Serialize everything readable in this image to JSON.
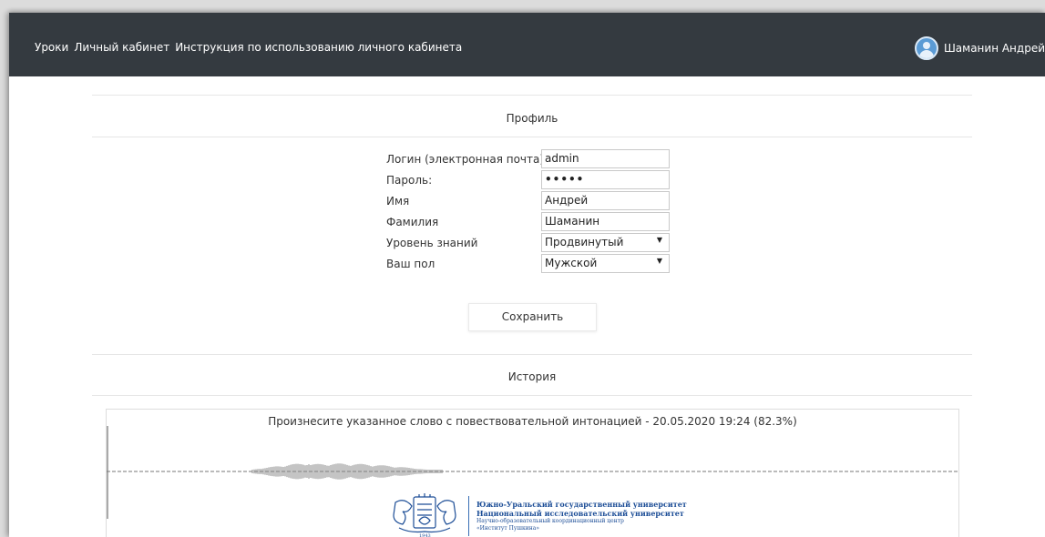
{
  "nav": {
    "links": [
      "Уроки",
      "Личный кабинет",
      "Инструкция по использованию личного кабинета"
    ],
    "user_name": "Шаманин Андрей"
  },
  "profile": {
    "title": "Профиль",
    "fields": [
      {
        "label": "Логин (электронная почта):",
        "value": "admin",
        "type": "text"
      },
      {
        "label": "Пароль:",
        "value": "•••••",
        "type": "password"
      },
      {
        "label": "Имя",
        "value": "Андрей",
        "type": "text"
      },
      {
        "label": "Фамилия",
        "value": "Шаманин",
        "type": "text"
      },
      {
        "label": "Уровень знаний",
        "value": "Продвинутый",
        "type": "select"
      },
      {
        "label": "Ваш пол",
        "value": "Мужской",
        "type": "select"
      }
    ],
    "save_label": "Сохранить"
  },
  "history": {
    "title": "История",
    "entry_title": "Произнесите указанное слово с повествовательной интонацией - 20.05.2020 19:24 (82.3%)"
  },
  "footer": {
    "university_line1": "Южно-Уральский государственный университет",
    "university_line2": "Национальный исследовательский университет",
    "university_line3": "Научно-образовательный координационный центр",
    "university_line4": "«Институт Пушкина»",
    "year": "1943"
  },
  "colors": {
    "navbar": "#343a40",
    "brand_blue": "#1d4e97"
  }
}
